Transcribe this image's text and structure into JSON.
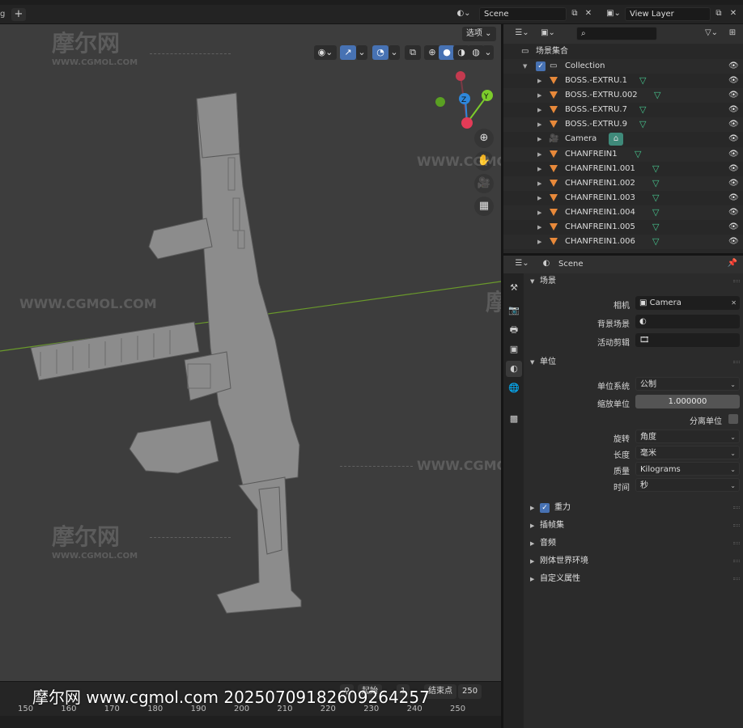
{
  "topbar": {
    "tab_fragment": "g",
    "add_tab": "+",
    "scene_field": "Scene",
    "view_layer_field": "View Layer"
  },
  "viewport": {
    "options_label": "选项",
    "view_icons": [
      "eye-icon",
      "arrows-icon",
      "overlay-icon",
      "xray-icon",
      "shading-wire",
      "shading-solid",
      "shading-material",
      "shading-rendered"
    ],
    "gizmo": {
      "z": "Z",
      "y": "Y"
    },
    "nav_icons": [
      "zoom-icon",
      "pan-hand-icon",
      "camera-view-icon",
      "perspective-grid-icon"
    ],
    "watermark_logo": "摩尔网",
    "watermark_site": "WWW.CGMOL.COM",
    "watermark_url": "WWW.CGMOL.COM"
  },
  "timeline": {
    "ticks": [
      "150",
      "160",
      "170",
      "180",
      "190",
      "200",
      "210",
      "220",
      "230",
      "240",
      "250"
    ],
    "start_label": "起始",
    "end_label": "结束点",
    "end_value": "250",
    "frame_value": "1"
  },
  "overlay_text": "摩尔网 www.cgmol.com 20250709182609264257",
  "outliner": {
    "search_placeholder": "",
    "root_label": "场景集合",
    "collection_label": "Collection",
    "items": [
      {
        "name": "BOSS.-EXTRU.1",
        "type": "mesh"
      },
      {
        "name": "BOSS.-EXTRU.002",
        "type": "mesh"
      },
      {
        "name": "BOSS.-EXTRU.7",
        "type": "mesh"
      },
      {
        "name": "BOSS.-EXTRU.9",
        "type": "mesh"
      },
      {
        "name": "Camera",
        "type": "camera"
      },
      {
        "name": "CHANFREIN1",
        "type": "mesh"
      },
      {
        "name": "CHANFREIN1.001",
        "type": "mesh"
      },
      {
        "name": "CHANFREIN1.002",
        "type": "mesh"
      },
      {
        "name": "CHANFREIN1.003",
        "type": "mesh"
      },
      {
        "name": "CHANFREIN1.004",
        "type": "mesh"
      },
      {
        "name": "CHANFREIN1.005",
        "type": "mesh"
      },
      {
        "name": "CHANFREIN1.006",
        "type": "mesh"
      }
    ],
    "eye_glyph": "👁"
  },
  "properties": {
    "context_label": "Scene",
    "scene_panel": {
      "title": "场景",
      "camera_label": "相机",
      "camera_value": "Camera",
      "background_label": "背景场景",
      "clip_label": "活动剪辑"
    },
    "units_panel": {
      "title": "单位",
      "system_label": "单位系统",
      "system_value": "公制",
      "scale_label": "缩放单位",
      "scale_value": "1.000000",
      "separate_label": "分离单位",
      "rotation_label": "旋转",
      "rotation_value": "角度",
      "length_label": "长度",
      "length_value": "毫米",
      "mass_label": "质量",
      "mass_value": "Kilograms",
      "time_label": "时间",
      "time_value": "秒"
    },
    "collapsed_panels": [
      {
        "title": "重力",
        "has_checkbox": true
      },
      {
        "title": "插帧集",
        "has_checkbox": false
      },
      {
        "title": "音频",
        "has_checkbox": false
      },
      {
        "title": "刚体世界环境",
        "has_checkbox": false
      },
      {
        "title": "自定义属性",
        "has_checkbox": false
      }
    ]
  },
  "colors": {
    "accent": "#4772b3",
    "mesh_icon": "#47c78f",
    "object_icon": "#e8893a",
    "axis_x": "#e33b57",
    "axis_y": "#7ccc2b",
    "axis_z": "#2e87dc"
  }
}
